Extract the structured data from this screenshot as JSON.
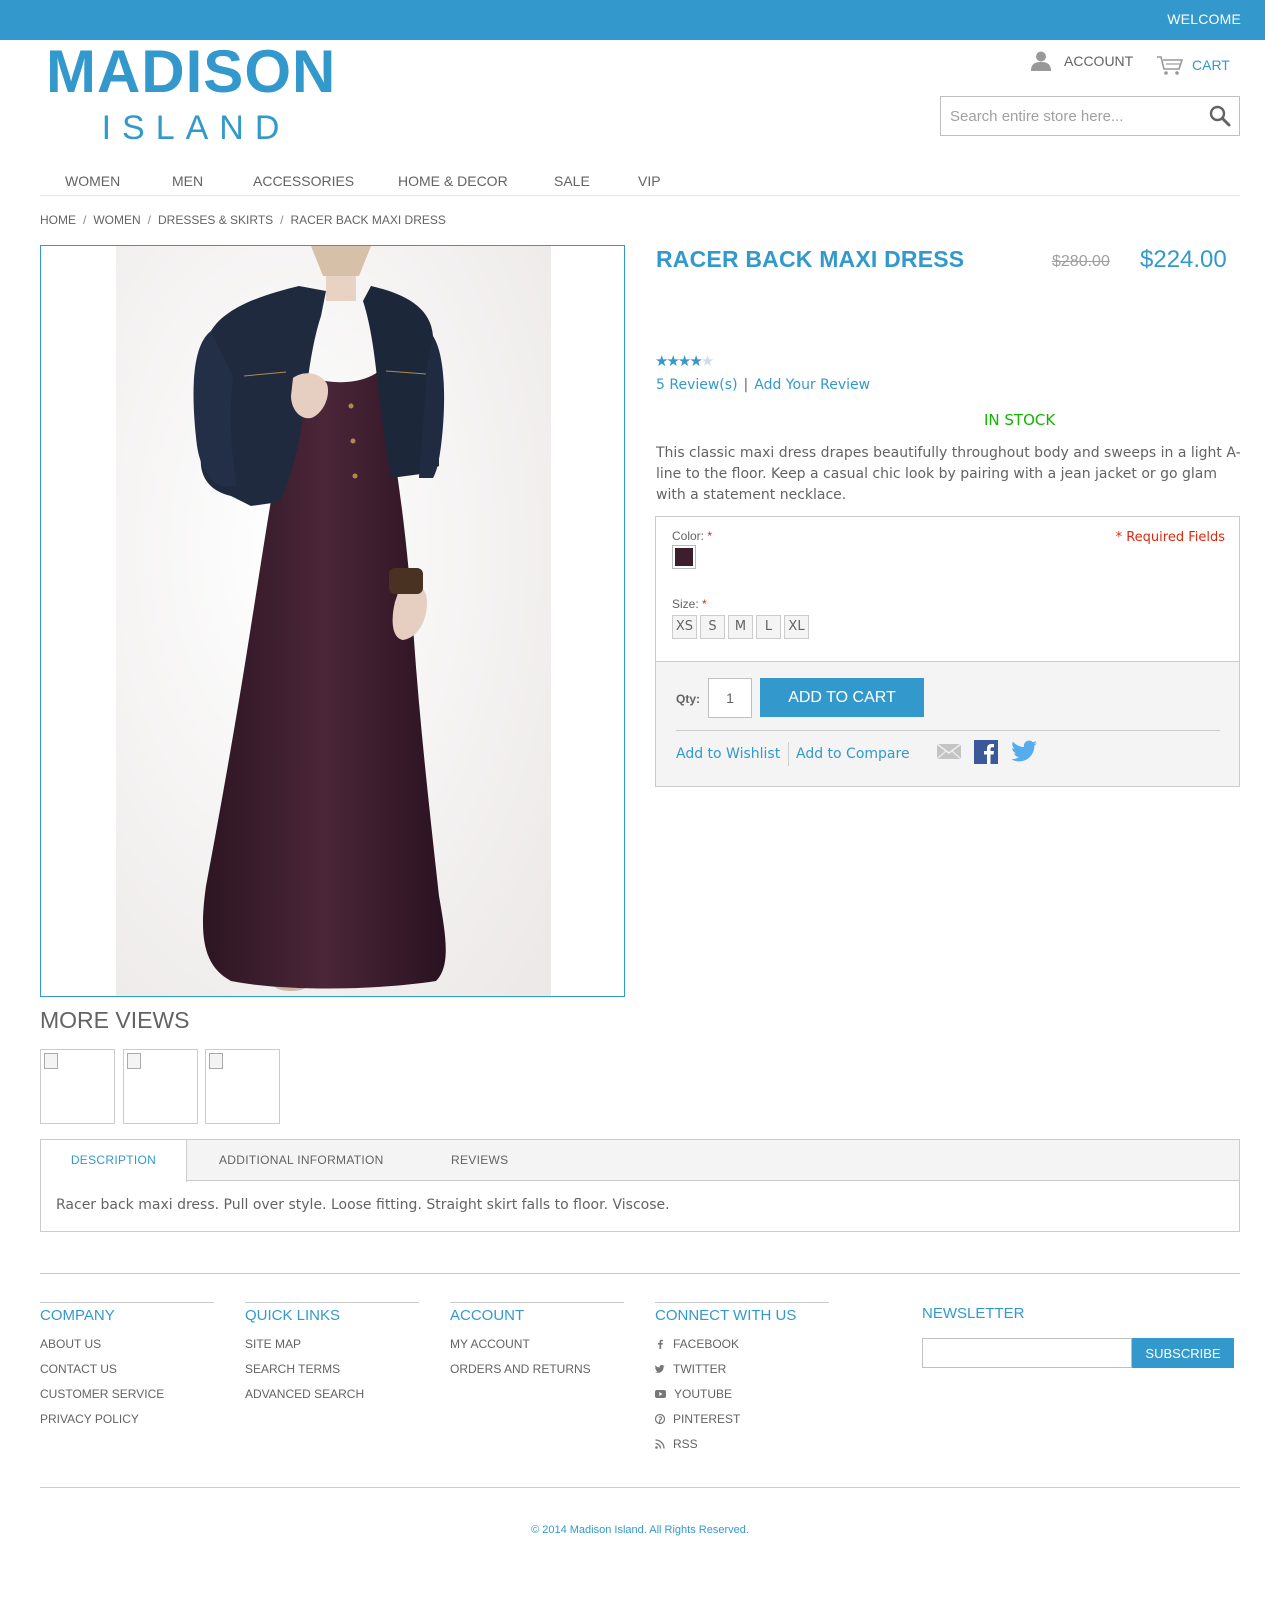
{
  "topbar": {
    "welcome": "WELCOME",
    "color": "#3399cc"
  },
  "logo": {
    "line1": "MADISON",
    "line2": "ISLAND"
  },
  "header": {
    "account_label": "ACCOUNT",
    "cart_label": "CART",
    "account_icon": "user-icon",
    "cart_icon": "cart-icon",
    "search": {
      "placeholder": "Search entire store here...",
      "icon": "search-icon"
    }
  },
  "nav": {
    "items": [
      "WOMEN",
      "MEN",
      "ACCESSORIES",
      "HOME & DECOR",
      "SALE",
      "VIP"
    ]
  },
  "breadcrumb": [
    "HOME",
    "WOMEN",
    "DRESSES & SKIRTS",
    "RACER BACK MAXI DRESS"
  ],
  "product": {
    "name": "RACER BACK MAXI DRESS",
    "old_price": "$280.00",
    "price": "$224.00",
    "rating_stars": 4,
    "rating_max": 5,
    "reviews_link": "5 Review(s)",
    "review_separator": "|",
    "add_review_link": "Add Your Review",
    "stock": "IN STOCK",
    "short_description": "This classic maxi dress drapes beautifully throughout body and sweeps in a light A-line to the floor. Keep a casual chic look by pairing with a jean jacket or go glam with a statement necklace.",
    "more_views": "MORE VIEWS",
    "thumbnail_count": 3
  },
  "options": {
    "color_label": "Color:",
    "required_mark": "*",
    "required_fields": "* Required Fields",
    "color_swatch": "#3d1e2c",
    "size_label": "Size:",
    "sizes": [
      "XS",
      "S",
      "M",
      "L",
      "XL"
    ]
  },
  "cart_box": {
    "qty_label": "Qty:",
    "qty_value": "1",
    "add_to_cart": "ADD TO CART",
    "wishlist": "Add to Wishlist",
    "compare": "Add to Compare",
    "share_icons": [
      "email-icon",
      "facebook-icon",
      "twitter-icon"
    ]
  },
  "tabs": {
    "items": [
      "DESCRIPTION",
      "ADDITIONAL INFORMATION",
      "REVIEWS"
    ],
    "active": "DESCRIPTION",
    "content": "Racer back maxi dress. Pull over style. Loose fitting. Straight skirt falls to floor. Viscose."
  },
  "footer": {
    "company": {
      "title": "COMPANY",
      "links": [
        "ABOUT US",
        "CONTACT US",
        "CUSTOMER SERVICE",
        "PRIVACY POLICY"
      ]
    },
    "quick_links": {
      "title": "QUICK LINKS",
      "links": [
        "SITE MAP",
        "SEARCH TERMS",
        "ADVANCED SEARCH"
      ]
    },
    "account": {
      "title": "ACCOUNT",
      "links": [
        "MY ACCOUNT",
        "ORDERS AND RETURNS"
      ]
    },
    "connect": {
      "title": "CONNECT WITH US",
      "links": [
        "FACEBOOK",
        "TWITTER",
        "YOUTUBE",
        "PINTEREST",
        "RSS"
      ]
    },
    "newsletter": {
      "title": "NEWSLETTER",
      "button": "SUBSCRIBE"
    },
    "copyright": "© 2014 Madison Island. All Rights Reserved."
  }
}
